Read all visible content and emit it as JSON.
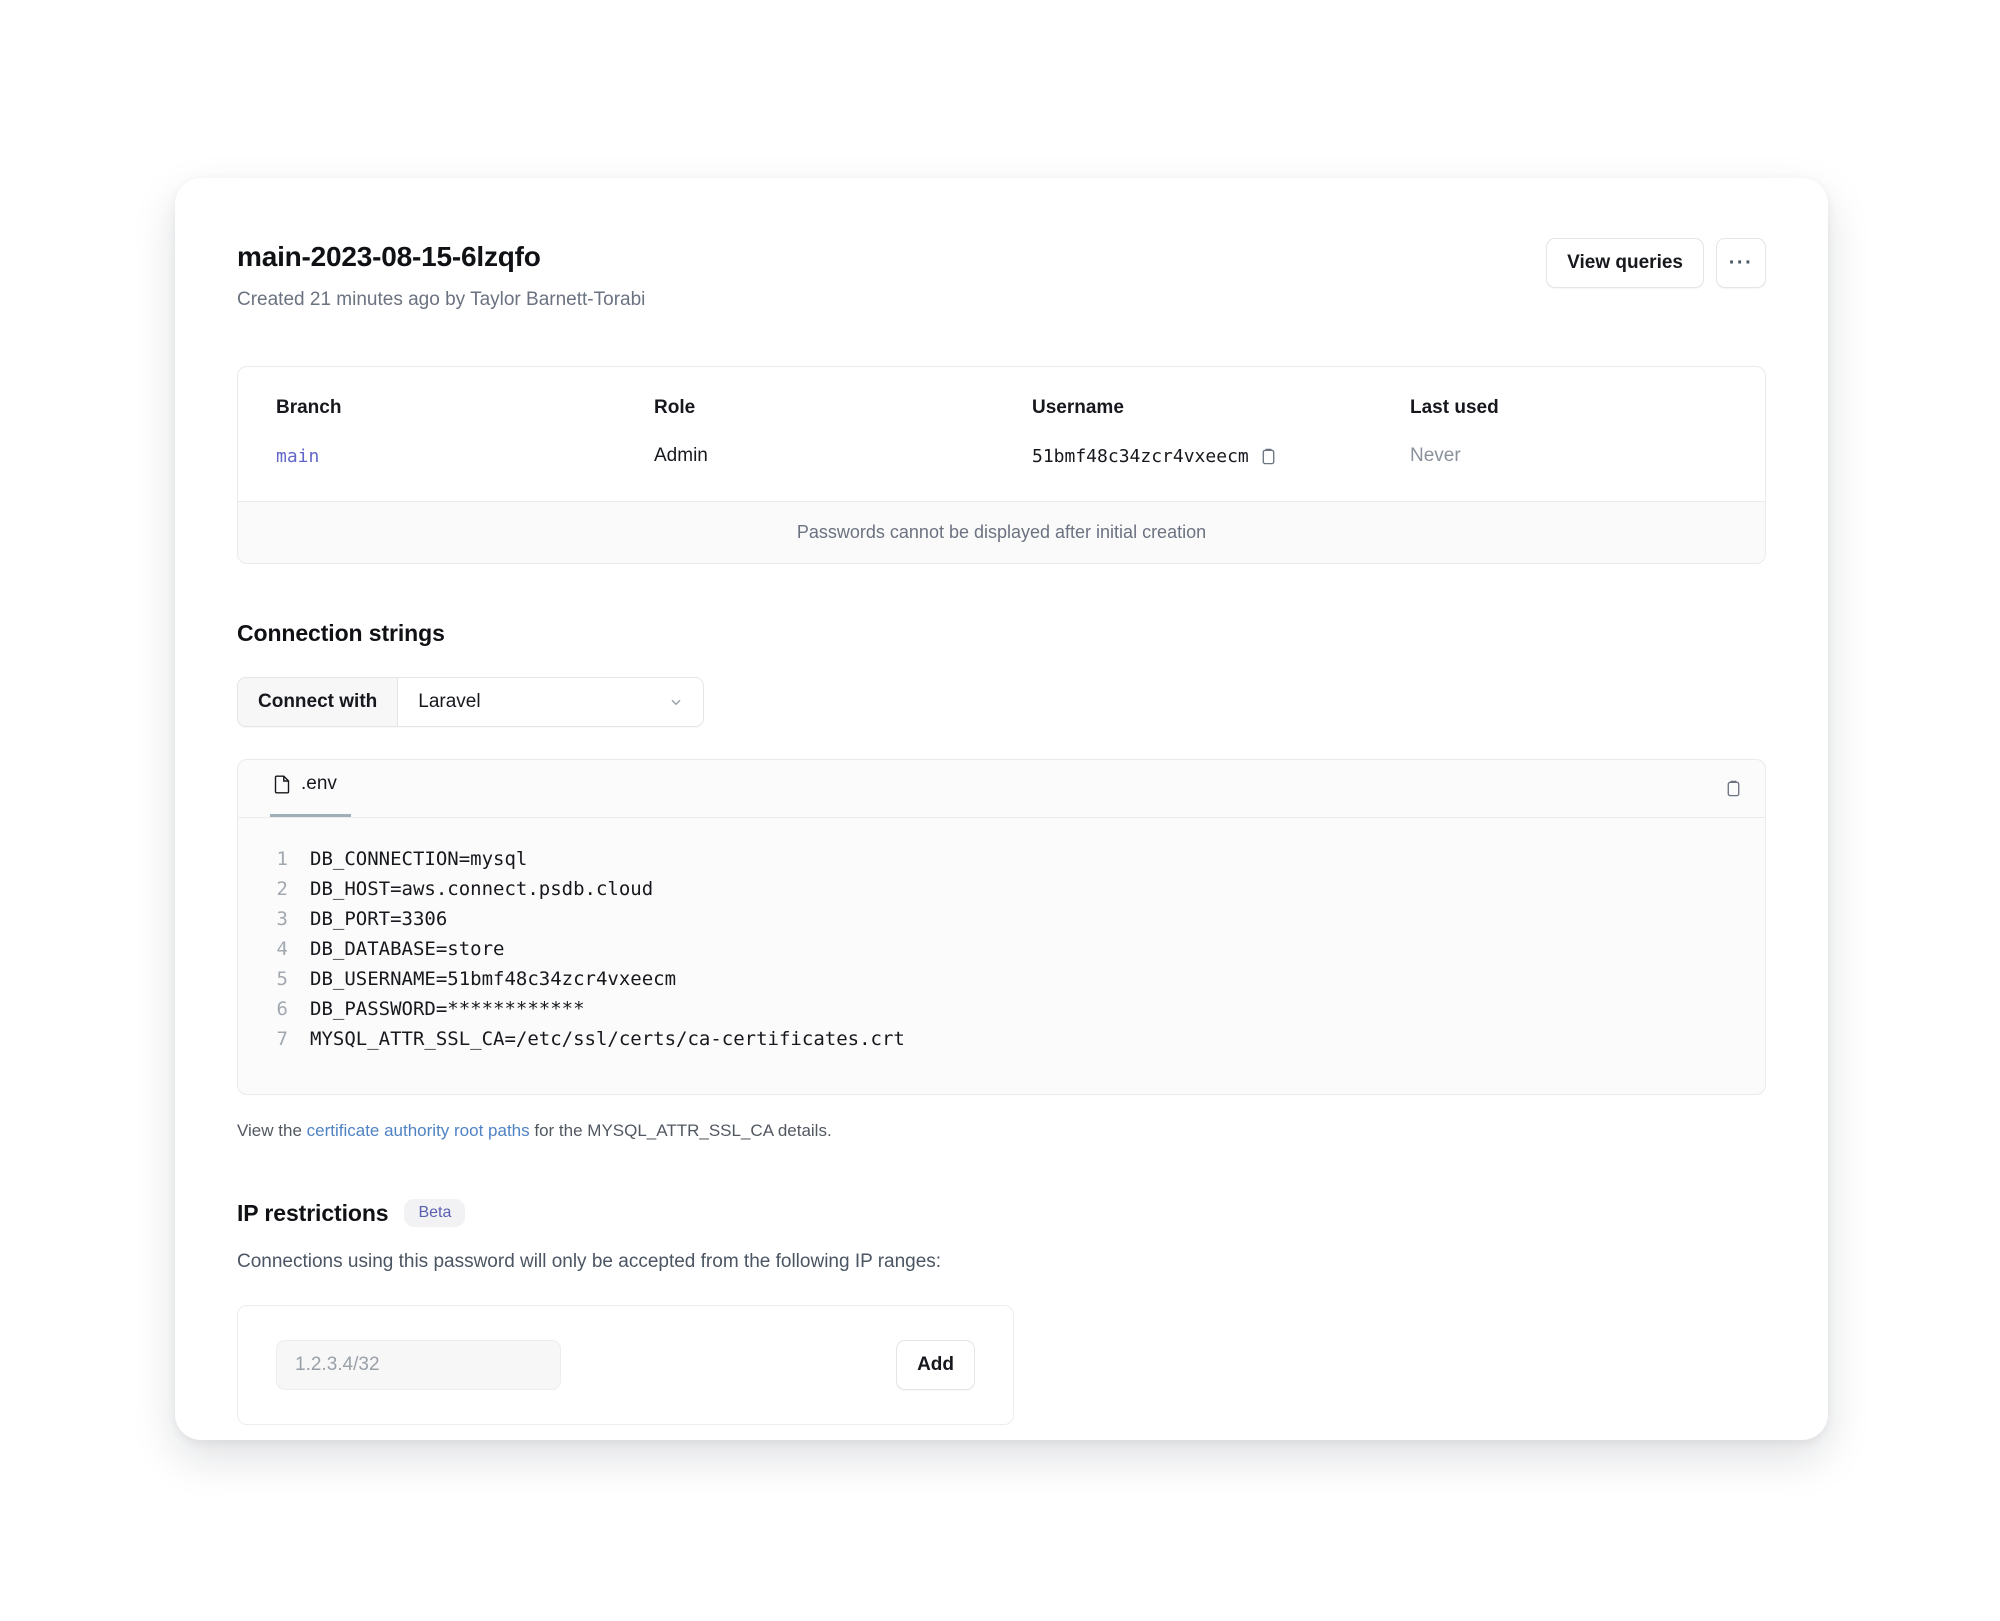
{
  "header": {
    "title": "main-2023-08-15-6lzqfo",
    "subtitle": "Created 21 minutes ago by Taylor Barnett-Torabi",
    "view_queries_label": "View queries",
    "more_label": "···"
  },
  "info_table": {
    "columns": [
      "Branch",
      "Role",
      "Username",
      "Last used"
    ],
    "values": {
      "branch": "main",
      "role": "Admin",
      "username": "51bmf48c34zcr4vxeecm",
      "last_used": "Never"
    },
    "note": "Passwords cannot be displayed after initial creation"
  },
  "connection_strings": {
    "title": "Connection strings",
    "connect_with_label": "Connect with",
    "framework_selected": "Laravel",
    "tab_label": ".env",
    "code_lines": [
      {
        "n": "1",
        "text": "DB_CONNECTION=mysql"
      },
      {
        "n": "2",
        "text": "DB_HOST=aws.connect.psdb.cloud"
      },
      {
        "n": "3",
        "text": "DB_PORT=3306"
      },
      {
        "n": "4",
        "text": "DB_DATABASE=store"
      },
      {
        "n": "5",
        "text": "DB_USERNAME=51bmf48c34zcr4vxeecm"
      },
      {
        "n": "6",
        "text": "DB_PASSWORD=************"
      },
      {
        "n": "7",
        "text": "MYSQL_ATTR_SSL_CA=/etc/ssl/certs/ca-certificates.crt"
      }
    ],
    "footnote_prefix": "View the ",
    "footnote_link": "certificate authority root paths",
    "footnote_suffix": " for the MYSQL_ATTR_SSL_CA details."
  },
  "ip_restrictions": {
    "title": "IP restrictions",
    "badge": "Beta",
    "description": "Connections using this password will only be accepted from the following IP ranges:",
    "input_placeholder": "1.2.3.4/32",
    "input_value": "",
    "add_label": "Add"
  },
  "colors": {
    "link": "#4f83c4",
    "branch_link": "#6366c8",
    "badge_text": "#5b5fb0",
    "tab_underline": "#9fb0b8"
  }
}
